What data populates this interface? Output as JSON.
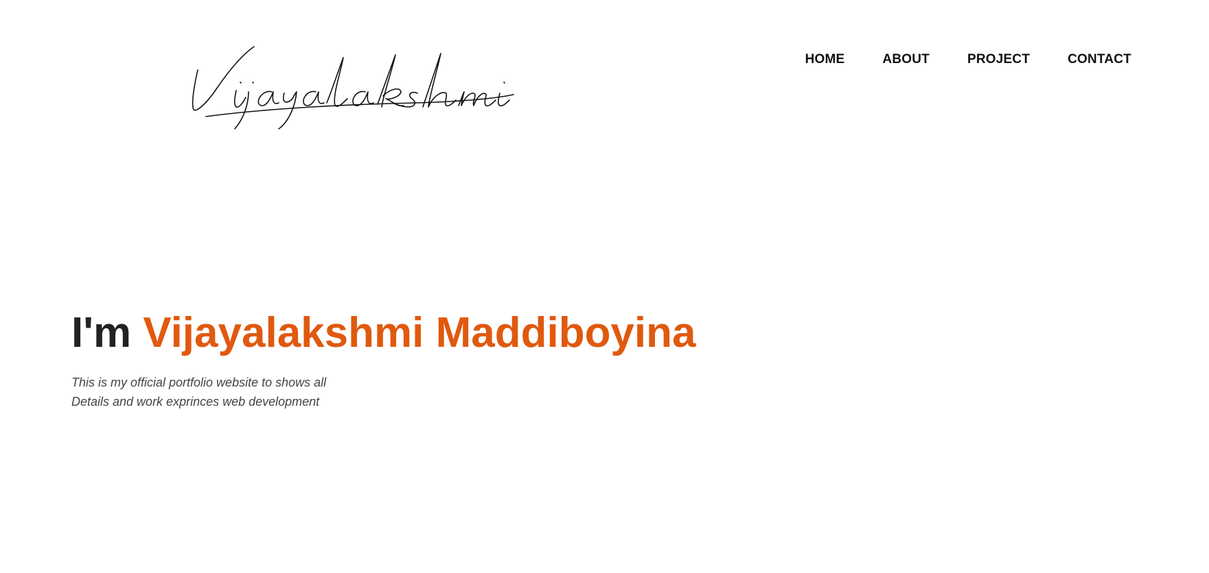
{
  "header": {
    "logo_text": "Vijayalakshmi",
    "nav": [
      {
        "label": "HOME"
      },
      {
        "label": "ABOUT"
      },
      {
        "label": "PROJECT"
      },
      {
        "label": "CONTACT"
      }
    ]
  },
  "hero": {
    "prefix": "I'm",
    "name": "Vijayalakshmi Maddiboyina",
    "description_line1": "This is my official portfolio website to shows all",
    "description_line2": "Details and work exprinces web development"
  },
  "colors": {
    "accent": "#e0590f",
    "heading": "#222222",
    "nav_text": "#111111",
    "body_text": "#444444",
    "background": "#ffffff"
  }
}
